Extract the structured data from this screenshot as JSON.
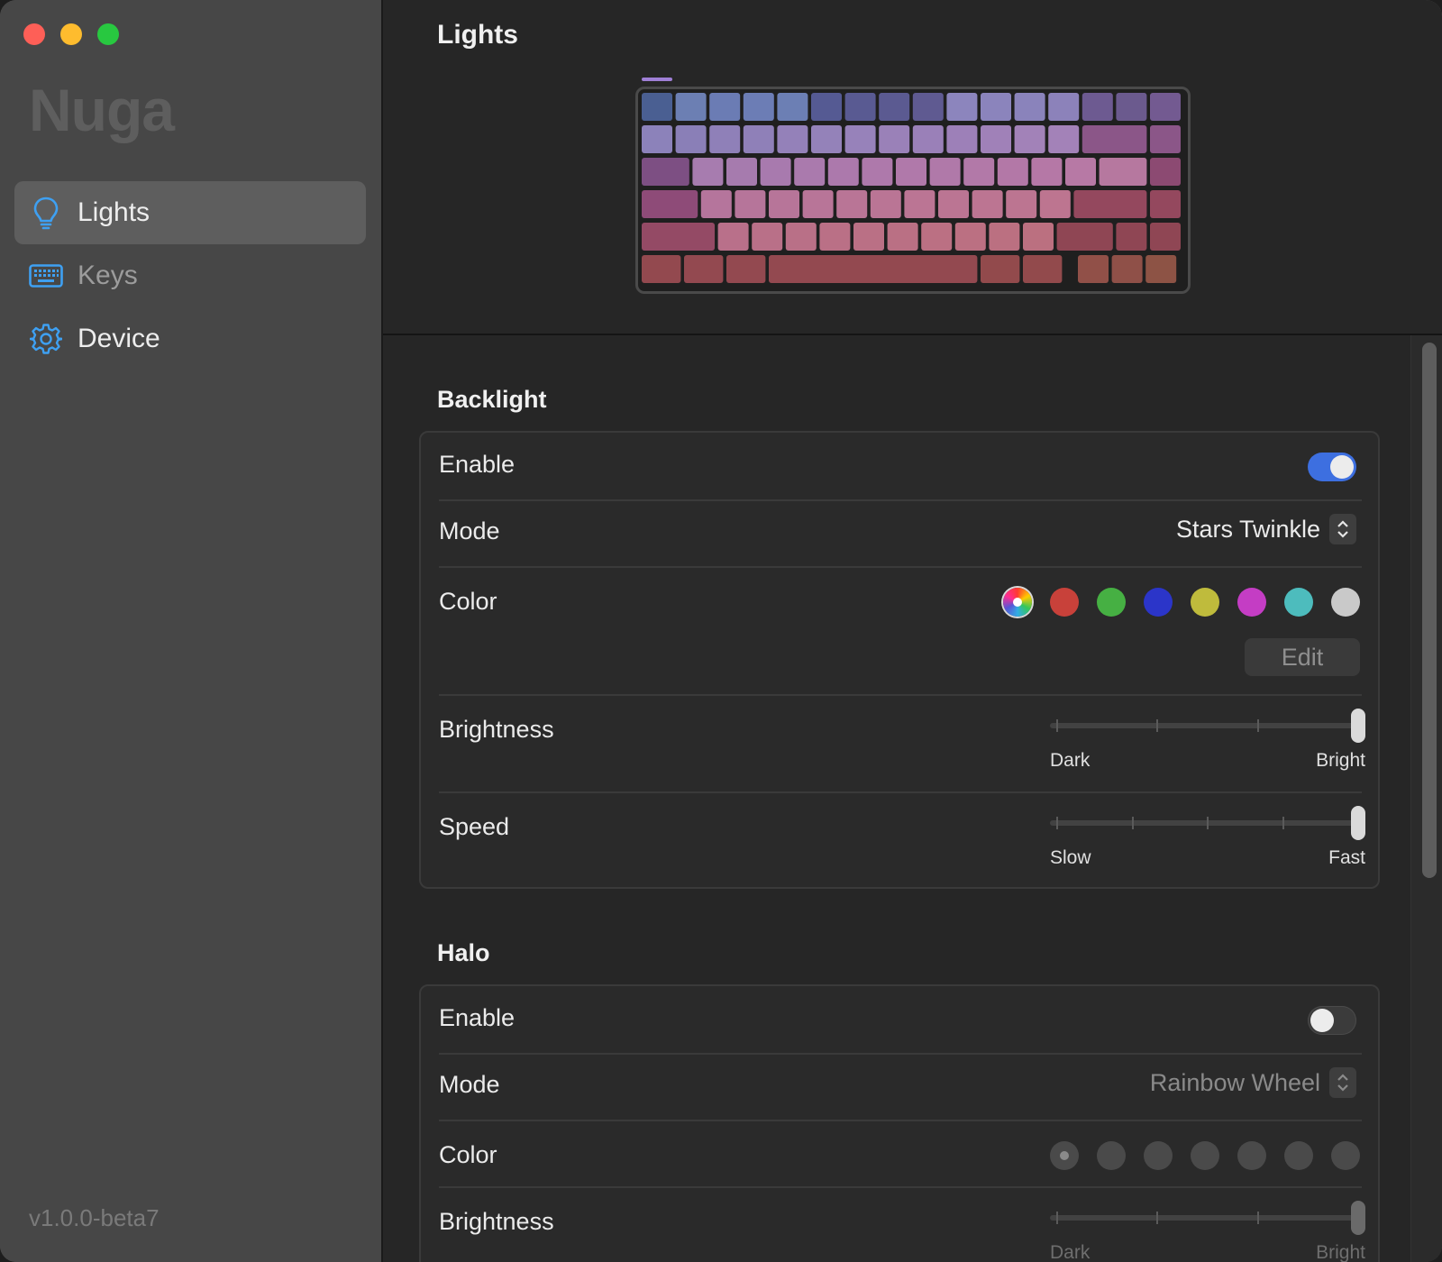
{
  "app": {
    "name": "Nuga",
    "version": "v1.0.0-beta7"
  },
  "sidebar": {
    "items": [
      {
        "label": "Lights",
        "icon": "lightbulb-icon",
        "active": true
      },
      {
        "label": "Keys",
        "icon": "keyboard-icon",
        "active": false
      },
      {
        "label": "Device",
        "icon": "gear-icon",
        "active": false
      }
    ]
  },
  "main": {
    "title": "Lights"
  },
  "backlight": {
    "title": "Backlight",
    "enable_label": "Enable",
    "enabled": true,
    "mode_label": "Mode",
    "mode_value": "Stars Twinkle",
    "color_label": "Color",
    "colors": [
      "rainbow",
      "#c8413a",
      "#46b043",
      "#2b35c9",
      "#bfbb3c",
      "#c43dc4",
      "#4dbcbd",
      "#c9c9c9"
    ],
    "selected_color_index": 0,
    "edit_label": "Edit",
    "brightness_label": "Brightness",
    "brightness_min_label": "Dark",
    "brightness_max_label": "Bright",
    "brightness_level": 1.0,
    "speed_label": "Speed",
    "speed_min_label": "Slow",
    "speed_max_label": "Fast",
    "speed_level": 1.0
  },
  "halo": {
    "title": "Halo",
    "enable_label": "Enable",
    "enabled": false,
    "mode_label": "Mode",
    "mode_value": "Rainbow Wheel",
    "color_label": "Color",
    "brightness_label": "Brightness",
    "brightness_min_label": "Dark",
    "brightness_max_label": "Bright",
    "brightness_level": 1.0
  },
  "keyboard_colors": {
    "row1": [
      "#4a5f92",
      "#6c7fb3",
      "#6b7cb4",
      "#6c7db5",
      "#6c7fb4",
      "#555a93",
      "#595a92",
      "#5b5a91",
      "#5f5a91",
      "#8c85bd",
      "#8b84bc",
      "#8a83bb",
      "#8c82ba",
      "#6d5a91",
      "#6b5a8e",
      "#735a91"
    ],
    "row2": [
      "#8c82ba",
      "#8a7fb7",
      "#8f80b8",
      "#8f80b8",
      "#9481b9",
      "#9482b9",
      "#9782ba",
      "#9a81b8",
      "#9a80b8",
      "#9d80b8",
      "#a081b8",
      "#a282b8",
      "#a382b8",
      "#8b5688",
      "#8b5688"
    ],
    "row3": [
      "#7d4f83",
      "#a77caf",
      "#a67bae",
      "#a87aae",
      "#aa7aad",
      "#ac79ac",
      "#ae79ab",
      "#b079aa",
      "#b079a9",
      "#b279a8",
      "#b378a7",
      "#b578a6",
      "#b779a5",
      "#b6789f",
      "#8c4a72"
    ],
    "row4": [
      "#8e4b78",
      "#b5759c",
      "#b6759a",
      "#b77599",
      "#b87598",
      "#b97596",
      "#ba7595",
      "#bb7594",
      "#bb7593",
      "#bc7592",
      "#bc7591",
      "#bd7590",
      "#94485e",
      "#94485e"
    ],
    "row5": [
      "#944a65",
      "#b9708a",
      "#b97088",
      "#b97087",
      "#ba7086",
      "#ba7085",
      "#ba7084",
      "#bb7083",
      "#bb7082",
      "#bb7081",
      "#bb7080",
      "#8f4654",
      "#8f4654",
      "#8f4654"
    ],
    "row6": [
      "#93494f",
      "#934950",
      "#934950",
      "#934950",
      "#924a4c",
      "#924a4c",
      "#915048",
      "#8f5048",
      "#8d5345"
    ]
  }
}
